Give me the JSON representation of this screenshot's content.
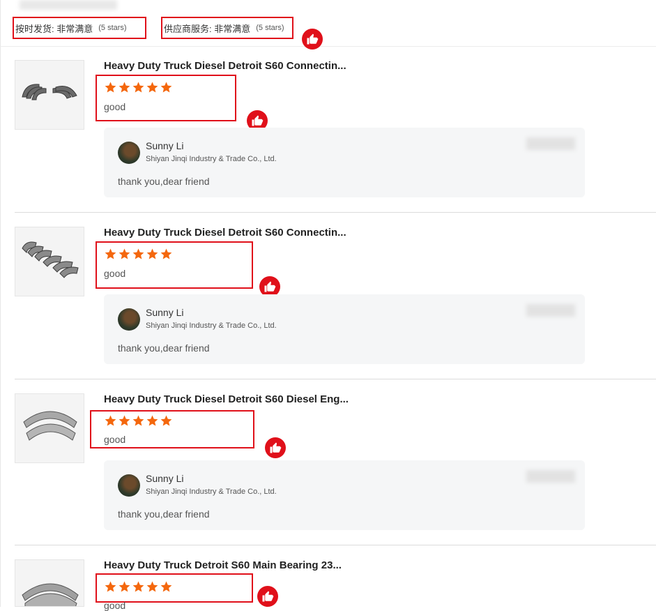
{
  "summary": {
    "on_time": {
      "label": "按时发货: 非常满意",
      "stars_text": "(5 stars)"
    },
    "service": {
      "label": "供应商服务: 非常满意",
      "stars_text": "(5 stars)"
    }
  },
  "colors": {
    "accent": "#e0101a",
    "star": "#f4670d",
    "reply_bg": "#f5f6f7"
  },
  "icons": {
    "like": "thumbs-up-icon",
    "star": "star-icon"
  },
  "reviews": [
    {
      "title": "Heavy Duty Truck Diesel Detroit S60 Connectin...",
      "rating": 5,
      "text": "good",
      "reply": {
        "name": "Sunny Li",
        "company": "Shiyan Jinqi Industry & Trade Co., Ltd.",
        "text": "thank you,dear friend"
      }
    },
    {
      "title": "Heavy Duty Truck Diesel Detroit S60 Connectin...",
      "rating": 5,
      "text": "good",
      "reply": {
        "name": "Sunny Li",
        "company": "Shiyan Jinqi Industry & Trade Co., Ltd.",
        "text": "thank you,dear friend"
      }
    },
    {
      "title": "Heavy Duty Truck Diesel Detroit S60 Diesel Eng...",
      "rating": 5,
      "text": "good",
      "reply": {
        "name": "Sunny Li",
        "company": "Shiyan Jinqi Industry & Trade Co., Ltd.",
        "text": "thank you,dear friend"
      }
    },
    {
      "title": "Heavy Duty Truck Detroit S60 Main Bearing 23...",
      "rating": 5,
      "text": "good"
    }
  ]
}
